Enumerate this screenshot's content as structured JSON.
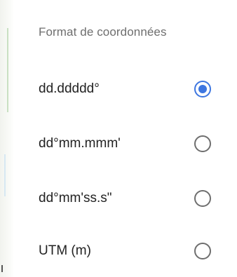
{
  "dialog": {
    "title": "Format de coordonnées",
    "accent_color": "#3d76e0",
    "selected_index": 0,
    "options": [
      {
        "label": "dd.ddddd°",
        "selected": true
      },
      {
        "label": "dd°mm.mmm'",
        "selected": false
      },
      {
        "label": "dd°mm'ss.s\"",
        "selected": false
      },
      {
        "label": "UTM (m)",
        "selected": false
      }
    ]
  }
}
